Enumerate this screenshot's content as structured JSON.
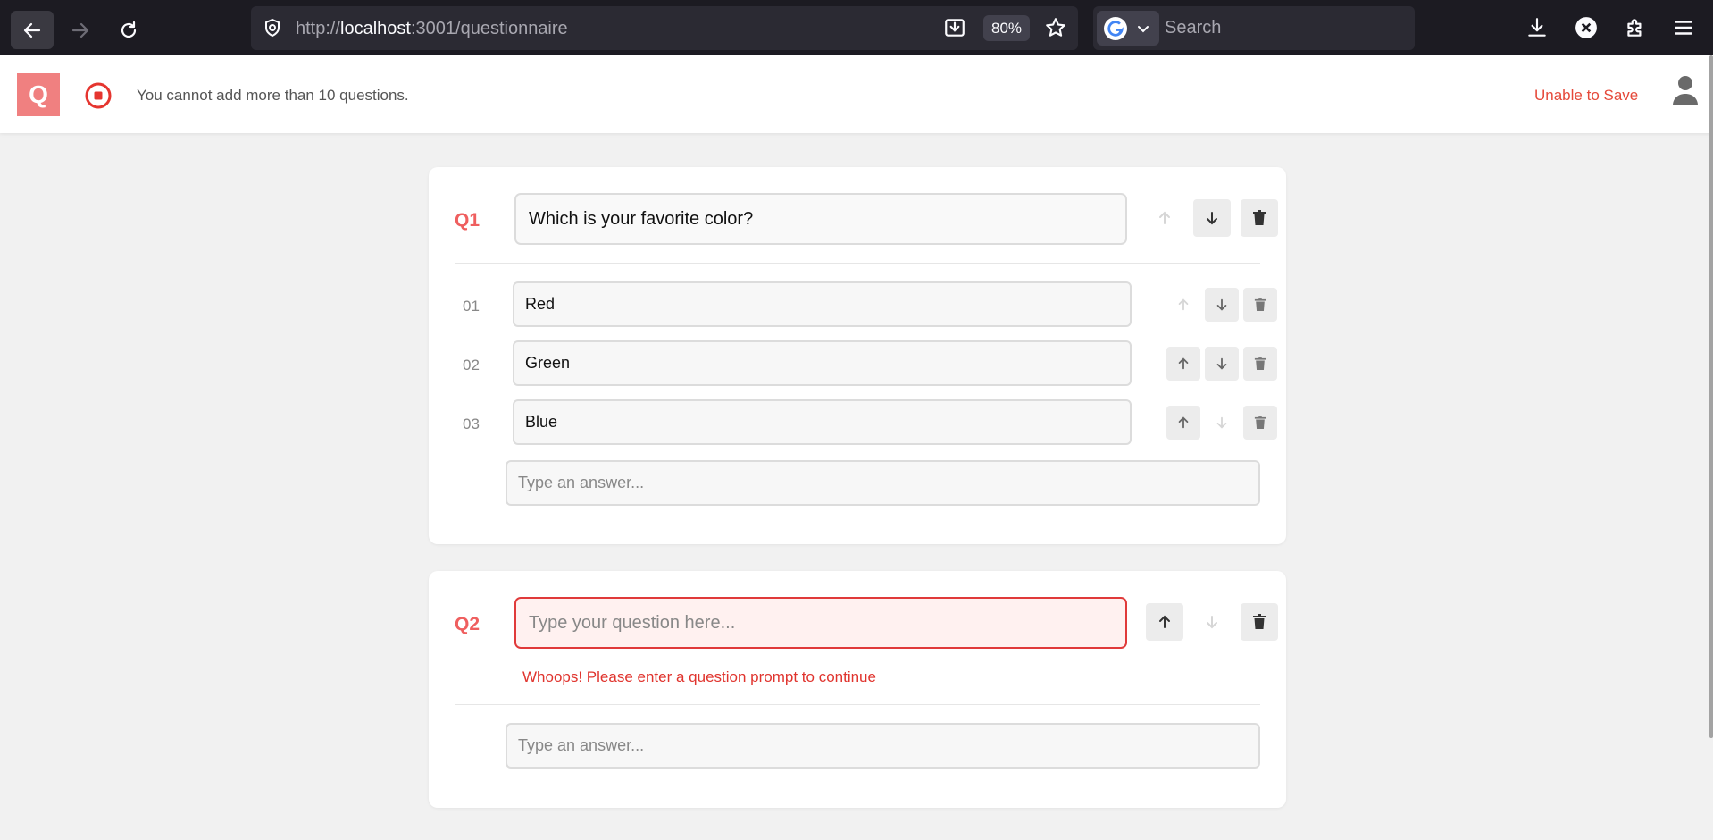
{
  "browser": {
    "url_prefix": "http://",
    "url_host": "localhost",
    "url_rest": ":3001/questionnaire",
    "zoom": "80%",
    "search_placeholder": "Search"
  },
  "header": {
    "logo_letter": "Q",
    "message": "You cannot add more than 10 questions.",
    "save_status": "Unable to Save"
  },
  "questions": [
    {
      "label": "Q1",
      "prompt": "Which is your favorite color?",
      "move_up_enabled": false,
      "move_down_enabled": true,
      "options": [
        {
          "num": "01",
          "text": "Red",
          "up_enabled": false,
          "down_enabled": true
        },
        {
          "num": "02",
          "text": "Green",
          "up_enabled": true,
          "down_enabled": true
        },
        {
          "num": "03",
          "text": "Blue",
          "up_enabled": true,
          "down_enabled": false
        }
      ],
      "answer_placeholder": "Type an answer..."
    },
    {
      "label": "Q2",
      "prompt": "",
      "prompt_placeholder": "Type your question here...",
      "move_up_enabled": true,
      "move_down_enabled": false,
      "error": "Whoops! Please enter a question prompt to continue",
      "answer_placeholder": "Type an answer..."
    }
  ],
  "colors": {
    "accent": "#ef5f5f",
    "error": "#e0342e",
    "logo_bg": "#f08080"
  }
}
